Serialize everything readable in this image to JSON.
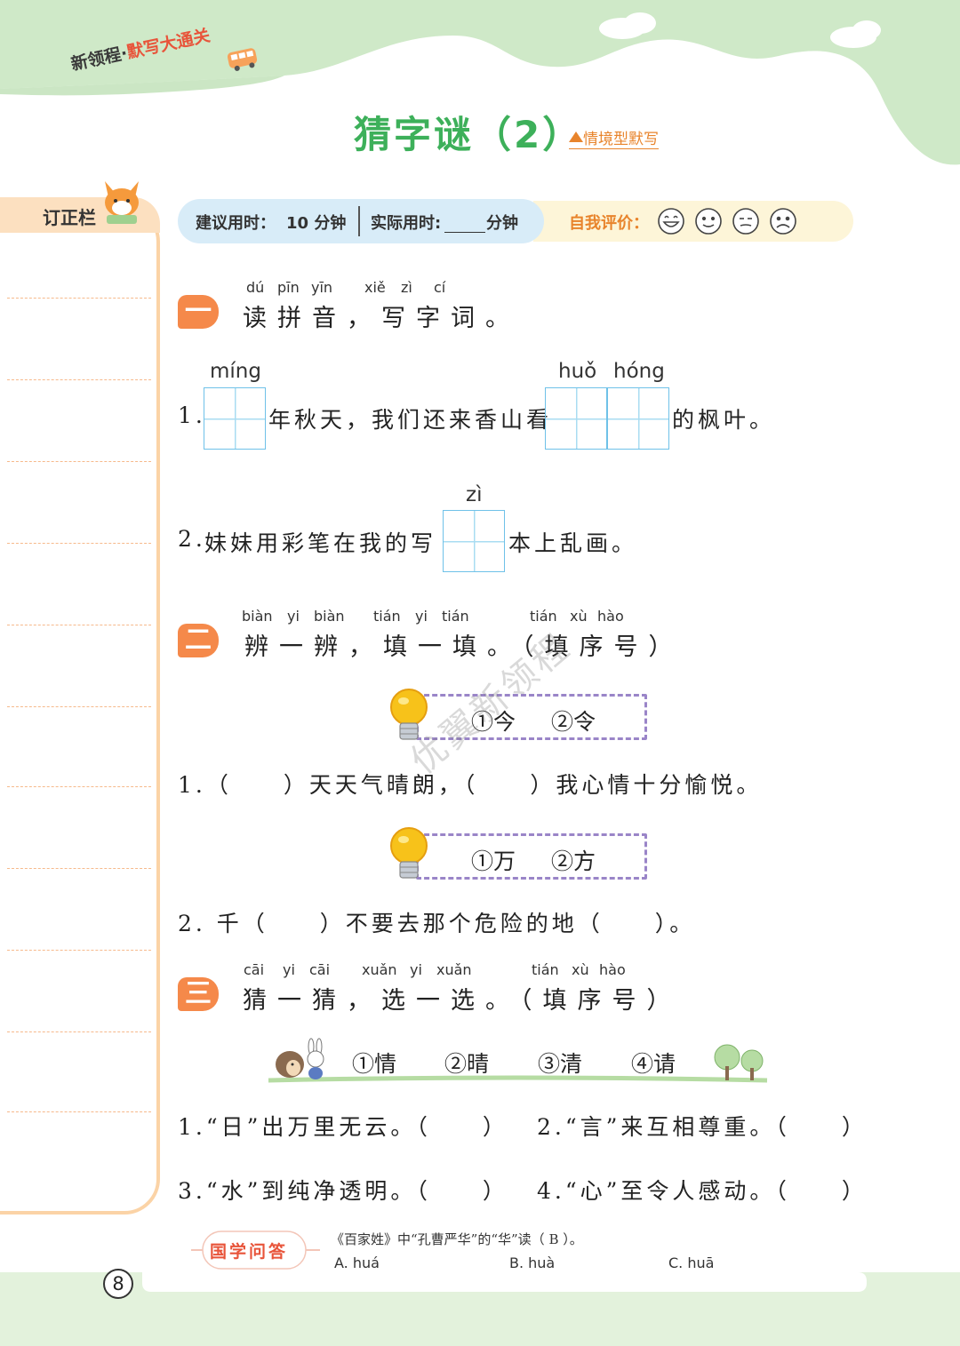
{
  "header": {
    "brand_part1": "新领程",
    "brand_dot": "·",
    "brand_part2": "默写大通关",
    "title": "猜字谜（2）",
    "tag": "情境型默写"
  },
  "correction": {
    "label": "订正栏"
  },
  "timebar": {
    "suggested_label": "建议用时：",
    "suggested_value": "10 分钟",
    "actual_label": "实际用时:",
    "actual_unit": "分钟",
    "self_eval_label": "自我评价："
  },
  "section1": {
    "badge": "一",
    "pinyin": [
      "dú",
      "pīn",
      "yīn",
      "xiě",
      "zì",
      "cí"
    ],
    "heading": "读拼音，写字词。",
    "q1": {
      "num": "1.",
      "pinyin_a": "míng",
      "text_a": "年秋天，我们还来香山看",
      "pinyin_b1": "huǒ",
      "pinyin_b2": "hóng",
      "text_b": "的枫叶。"
    },
    "q2": {
      "num": "2.",
      "text_a": "妹妹用彩笔在我的写",
      "pinyin": "zì",
      "text_b": "本上乱画。"
    }
  },
  "section2": {
    "badge": "二",
    "pinyin": [
      "biàn",
      "yi",
      "biàn",
      "tián",
      "yi",
      "tián",
      "tián",
      "xù",
      "hào"
    ],
    "heading": "辨一辨，填一填。（填序号）",
    "group1": {
      "options": [
        "①今",
        "②令"
      ],
      "sentence": "1.（　　）天天气晴朗，（　　）我心情十分愉悦。"
    },
    "group2": {
      "options": [
        "①万",
        "②方"
      ],
      "sentence": "2. 千（　　）不要去那个危险的地（　　）。"
    }
  },
  "section3": {
    "badge": "三",
    "pinyin": [
      "cāi",
      "yi",
      "cāi",
      "xuǎn",
      "yi",
      "xuǎn",
      "tián",
      "xù",
      "hào"
    ],
    "heading": "猜一猜，选一选。（填序号）",
    "options": [
      "①情",
      "②晴",
      "③清",
      "④请"
    ],
    "questions": [
      "1.“日”出万里无云。（　　）",
      "2.“言”来互相尊重。（　　）",
      "3.“水”到纯净透明。（　　）",
      "4.“心”至令人感动。（　　）"
    ]
  },
  "footer": {
    "badge": "国学问答",
    "question": "《百家姓》中“孔曹严华”的“华”读（ B ）。",
    "answers": [
      "A. huá",
      "B. huà",
      "C. huā"
    ],
    "page": "8"
  },
  "watermark": "优翼新领程",
  "colors": {
    "accent_green": "#3db05a",
    "accent_orange": "#f5894a",
    "grid_blue": "#6fc1e8",
    "option_border": "#9a85c8"
  }
}
